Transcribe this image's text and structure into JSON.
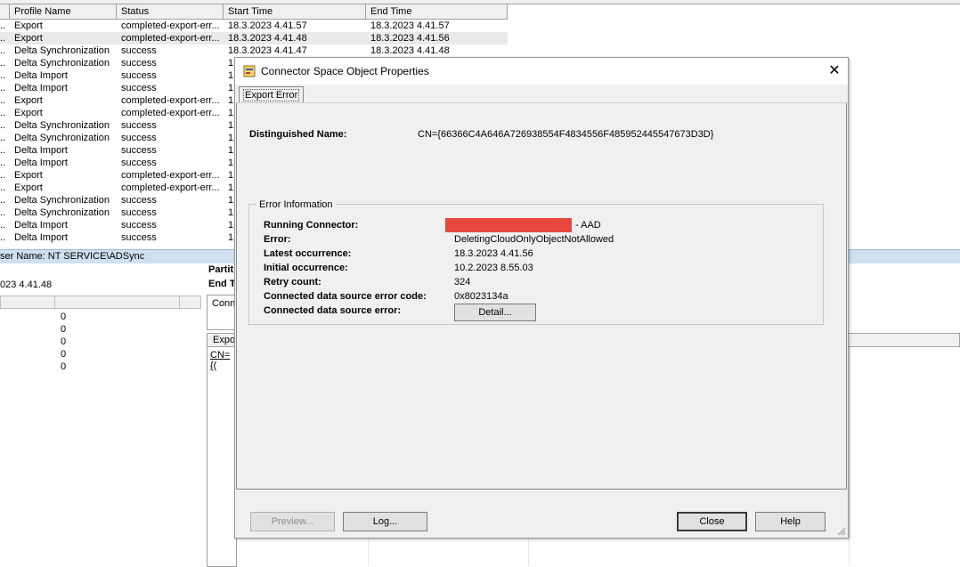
{
  "grid": {
    "columns": [
      "Profile Name",
      "Status",
      "Start Time",
      "End Time"
    ],
    "rows": [
      {
        "profile": "Export",
        "status": "completed-export-err...",
        "start": "18.3.2023 4.41.57",
        "end": "18.3.2023 4.41.57"
      },
      {
        "profile": "Export",
        "status": "completed-export-err...",
        "start": "18.3.2023 4.41.48",
        "end": "18.3.2023 4.41.56"
      },
      {
        "profile": "Delta Synchronization",
        "status": "success",
        "start": "18.3.2023 4.41.47",
        "end": "18.3.2023 4.41.48"
      },
      {
        "profile": "Delta Synchronization",
        "status": "success",
        "start": "1",
        "end": ""
      },
      {
        "profile": "Delta Import",
        "status": "success",
        "start": "1",
        "end": ""
      },
      {
        "profile": "Delta Import",
        "status": "success",
        "start": "1",
        "end": ""
      },
      {
        "profile": "Export",
        "status": "completed-export-err...",
        "start": "1",
        "end": ""
      },
      {
        "profile": "Export",
        "status": "completed-export-err...",
        "start": "1",
        "end": ""
      },
      {
        "profile": "Delta Synchronization",
        "status": "success",
        "start": "1",
        "end": ""
      },
      {
        "profile": "Delta Synchronization",
        "status": "success",
        "start": "1",
        "end": ""
      },
      {
        "profile": "Delta Import",
        "status": "success",
        "start": "1",
        "end": ""
      },
      {
        "profile": "Delta Import",
        "status": "success",
        "start": "1",
        "end": ""
      },
      {
        "profile": "Export",
        "status": "completed-export-err...",
        "start": "1",
        "end": ""
      },
      {
        "profile": "Export",
        "status": "completed-export-err...",
        "start": "1",
        "end": ""
      },
      {
        "profile": "Delta Synchronization",
        "status": "success",
        "start": "1",
        "end": ""
      },
      {
        "profile": "Delta Synchronization",
        "status": "success",
        "start": "1",
        "end": ""
      },
      {
        "profile": "Delta Import",
        "status": "success",
        "start": "1",
        "end": ""
      },
      {
        "profile": "Delta Import",
        "status": "success",
        "start": "1",
        "end": ""
      }
    ]
  },
  "lower": {
    "user_name": "ser Name: NT SERVICE\\ADSync",
    "end_time": "023 4.41.48",
    "partition_label": "Partit",
    "end_label": "End T",
    "conn_label": "Conn",
    "export_label": "Expor",
    "cn_link": "CN={(",
    "zeros": [
      "0",
      "0",
      "0",
      "0",
      "0"
    ]
  },
  "dialog": {
    "title": "Connector Space Object Properties",
    "close_glyph": "✕",
    "tab_label": "Export Error",
    "dn_label": "Distinguished Name:",
    "dn_value": "CN={66366C4A646A726938554F4834556F485952445547673D3D}",
    "error_group_title": "Error Information",
    "fields": {
      "running_connector_label": "Running Connector:",
      "running_connector_value": "- AAD",
      "error_label": "Error:",
      "error_value": "DeletingCloudOnlyObjectNotAllowed",
      "latest_label": "Latest occurrence:",
      "latest_value": "18.3.2023 4.41.56",
      "initial_label": "Initial occurrence:",
      "initial_value": "10.2.2023 8.55.03",
      "retry_label": "Retry count:",
      "retry_value": "324",
      "code_label": "Connected data source error code:",
      "code_value": "0x8023134a",
      "cds_error_label": "Connected data source error:"
    },
    "buttons": {
      "detail": "Detail...",
      "preview": "Preview...",
      "log": "Log...",
      "close": "Close",
      "help": "Help"
    },
    "redaction_color": "#e8473d"
  }
}
